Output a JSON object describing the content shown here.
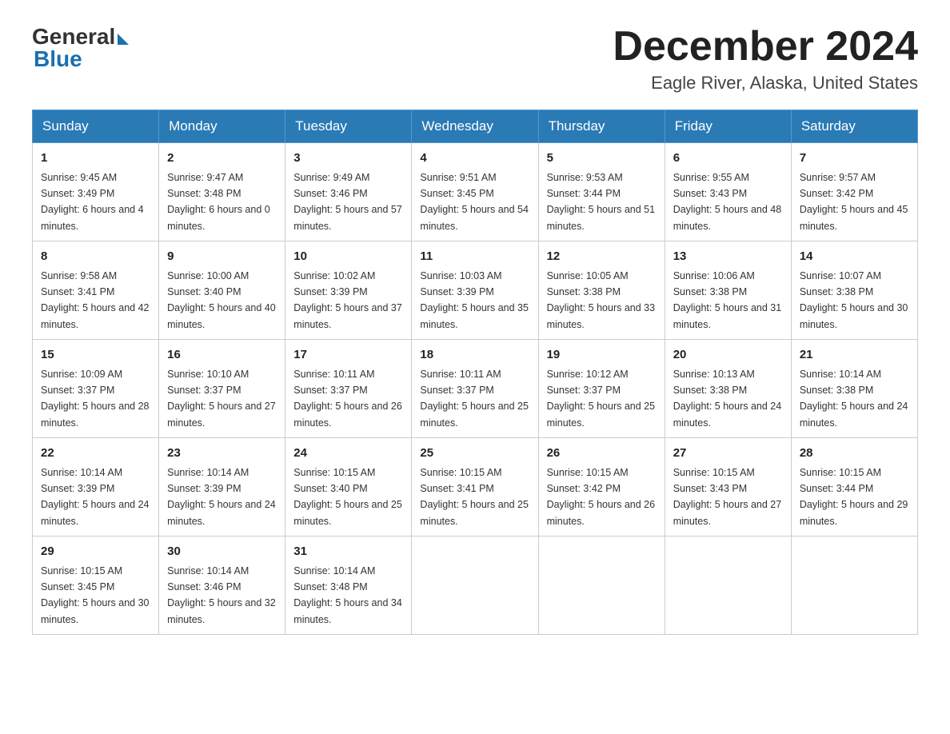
{
  "header": {
    "logo_general": "General",
    "logo_blue": "Blue",
    "month_title": "December 2024",
    "location": "Eagle River, Alaska, United States"
  },
  "calendar": {
    "days_of_week": [
      "Sunday",
      "Monday",
      "Tuesday",
      "Wednesday",
      "Thursday",
      "Friday",
      "Saturday"
    ],
    "weeks": [
      [
        {
          "date": "1",
          "sunrise": "9:45 AM",
          "sunset": "3:49 PM",
          "daylight": "6 hours and 4 minutes."
        },
        {
          "date": "2",
          "sunrise": "9:47 AM",
          "sunset": "3:48 PM",
          "daylight": "6 hours and 0 minutes."
        },
        {
          "date": "3",
          "sunrise": "9:49 AM",
          "sunset": "3:46 PM",
          "daylight": "5 hours and 57 minutes."
        },
        {
          "date": "4",
          "sunrise": "9:51 AM",
          "sunset": "3:45 PM",
          "daylight": "5 hours and 54 minutes."
        },
        {
          "date": "5",
          "sunrise": "9:53 AM",
          "sunset": "3:44 PM",
          "daylight": "5 hours and 51 minutes."
        },
        {
          "date": "6",
          "sunrise": "9:55 AM",
          "sunset": "3:43 PM",
          "daylight": "5 hours and 48 minutes."
        },
        {
          "date": "7",
          "sunrise": "9:57 AM",
          "sunset": "3:42 PM",
          "daylight": "5 hours and 45 minutes."
        }
      ],
      [
        {
          "date": "8",
          "sunrise": "9:58 AM",
          "sunset": "3:41 PM",
          "daylight": "5 hours and 42 minutes."
        },
        {
          "date": "9",
          "sunrise": "10:00 AM",
          "sunset": "3:40 PM",
          "daylight": "5 hours and 40 minutes."
        },
        {
          "date": "10",
          "sunrise": "10:02 AM",
          "sunset": "3:39 PM",
          "daylight": "5 hours and 37 minutes."
        },
        {
          "date": "11",
          "sunrise": "10:03 AM",
          "sunset": "3:39 PM",
          "daylight": "5 hours and 35 minutes."
        },
        {
          "date": "12",
          "sunrise": "10:05 AM",
          "sunset": "3:38 PM",
          "daylight": "5 hours and 33 minutes."
        },
        {
          "date": "13",
          "sunrise": "10:06 AM",
          "sunset": "3:38 PM",
          "daylight": "5 hours and 31 minutes."
        },
        {
          "date": "14",
          "sunrise": "10:07 AM",
          "sunset": "3:38 PM",
          "daylight": "5 hours and 30 minutes."
        }
      ],
      [
        {
          "date": "15",
          "sunrise": "10:09 AM",
          "sunset": "3:37 PM",
          "daylight": "5 hours and 28 minutes."
        },
        {
          "date": "16",
          "sunrise": "10:10 AM",
          "sunset": "3:37 PM",
          "daylight": "5 hours and 27 minutes."
        },
        {
          "date": "17",
          "sunrise": "10:11 AM",
          "sunset": "3:37 PM",
          "daylight": "5 hours and 26 minutes."
        },
        {
          "date": "18",
          "sunrise": "10:11 AM",
          "sunset": "3:37 PM",
          "daylight": "5 hours and 25 minutes."
        },
        {
          "date": "19",
          "sunrise": "10:12 AM",
          "sunset": "3:37 PM",
          "daylight": "5 hours and 25 minutes."
        },
        {
          "date": "20",
          "sunrise": "10:13 AM",
          "sunset": "3:38 PM",
          "daylight": "5 hours and 24 minutes."
        },
        {
          "date": "21",
          "sunrise": "10:14 AM",
          "sunset": "3:38 PM",
          "daylight": "5 hours and 24 minutes."
        }
      ],
      [
        {
          "date": "22",
          "sunrise": "10:14 AM",
          "sunset": "3:39 PM",
          "daylight": "5 hours and 24 minutes."
        },
        {
          "date": "23",
          "sunrise": "10:14 AM",
          "sunset": "3:39 PM",
          "daylight": "5 hours and 24 minutes."
        },
        {
          "date": "24",
          "sunrise": "10:15 AM",
          "sunset": "3:40 PM",
          "daylight": "5 hours and 25 minutes."
        },
        {
          "date": "25",
          "sunrise": "10:15 AM",
          "sunset": "3:41 PM",
          "daylight": "5 hours and 25 minutes."
        },
        {
          "date": "26",
          "sunrise": "10:15 AM",
          "sunset": "3:42 PM",
          "daylight": "5 hours and 26 minutes."
        },
        {
          "date": "27",
          "sunrise": "10:15 AM",
          "sunset": "3:43 PM",
          "daylight": "5 hours and 27 minutes."
        },
        {
          "date": "28",
          "sunrise": "10:15 AM",
          "sunset": "3:44 PM",
          "daylight": "5 hours and 29 minutes."
        }
      ],
      [
        {
          "date": "29",
          "sunrise": "10:15 AM",
          "sunset": "3:45 PM",
          "daylight": "5 hours and 30 minutes."
        },
        {
          "date": "30",
          "sunrise": "10:14 AM",
          "sunset": "3:46 PM",
          "daylight": "5 hours and 32 minutes."
        },
        {
          "date": "31",
          "sunrise": "10:14 AM",
          "sunset": "3:48 PM",
          "daylight": "5 hours and 34 minutes."
        },
        null,
        null,
        null,
        null
      ]
    ]
  }
}
